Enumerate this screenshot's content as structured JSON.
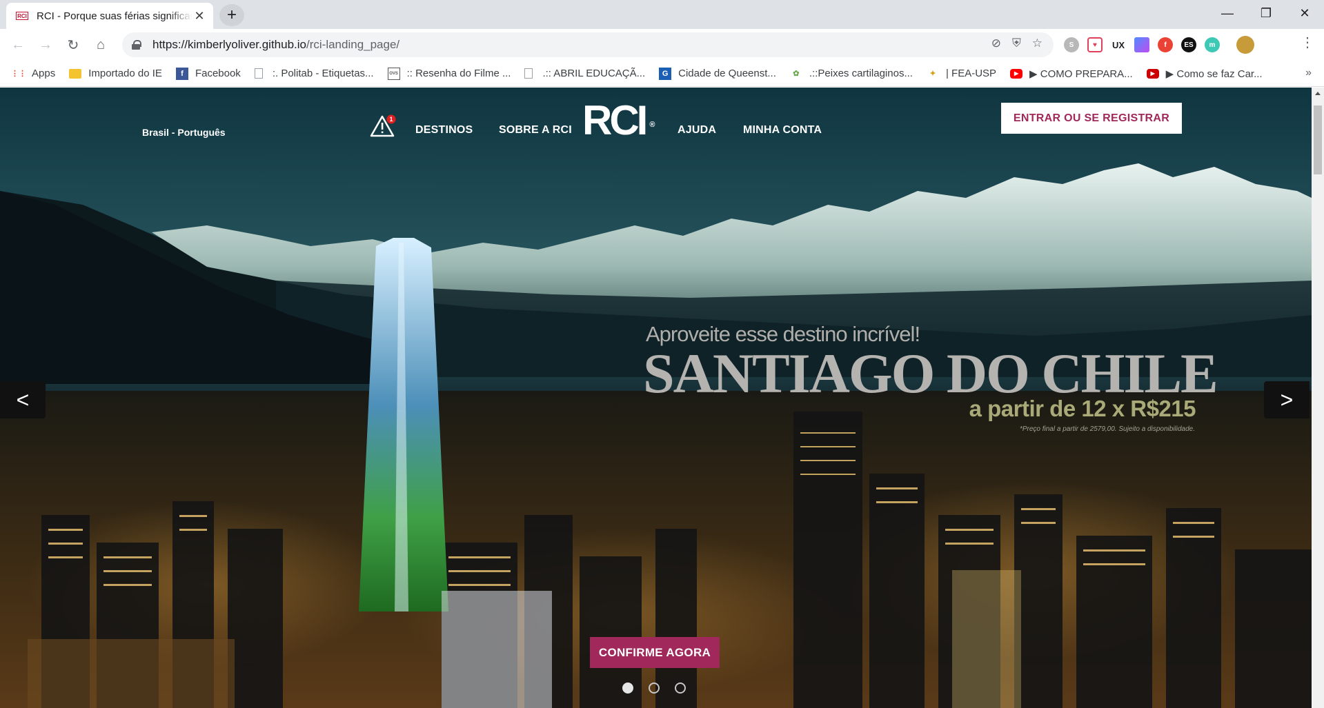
{
  "browser": {
    "tab": {
      "title": "RCI - Porque suas férias significam",
      "favicon_text": "RCI"
    },
    "new_tab_symbol": "+",
    "window_controls": {
      "minimize": "—",
      "maximize": "❐",
      "close": "✕"
    },
    "nav": {
      "back": "←",
      "forward": "→",
      "reload": "↻",
      "home": "⌂"
    },
    "url": {
      "host": "https://kimberlyoliver.github.io",
      "path": "/rci-landing_page/"
    },
    "omnibox_icons": [
      "translate-icon",
      "shield-icon",
      "star-icon"
    ],
    "extensions": [
      {
        "name": "skype-icon",
        "text": "S",
        "color": "#b8b8b8"
      },
      {
        "name": "pocket-icon",
        "text": "♥",
        "color": "#e0405a"
      },
      {
        "name": "ux-icon",
        "text": "UX",
        "color": "#202124"
      },
      {
        "name": "gradient-icon",
        "text": "",
        "color": "#8a5cf6"
      },
      {
        "name": "red-ext-icon",
        "text": "f",
        "color": "#ea4335"
      },
      {
        "name": "es-icon",
        "text": "ES",
        "color": "#111111"
      },
      {
        "name": "m-icon",
        "text": "m",
        "color": "#3ec9b6"
      },
      {
        "name": "profile-avatar",
        "text": "",
        "color": "#c79a3a"
      }
    ],
    "bookmarks": [
      {
        "label": "Apps",
        "icon": "apps-grid-icon",
        "glyph": "⋮⋮",
        "color": "#ea4335"
      },
      {
        "label": "Importado do IE",
        "icon": "folder-icon",
        "glyph": "",
        "color": "#f4c430"
      },
      {
        "label": "Facebook",
        "icon": "facebook-icon",
        "glyph": "f",
        "color": "#3b5998"
      },
      {
        "label": ":. Politab - Etiquetas...",
        "icon": "page-icon",
        "glyph": "",
        "color": "#9aa0a6"
      },
      {
        "label": ":: Resenha do Filme ...",
        "icon": "ovs-icon",
        "glyph": "OVS",
        "color": "#555555"
      },
      {
        "label": ".:: ABRIL EDUCAÇÃ...",
        "icon": "page-icon",
        "glyph": "",
        "color": "#9aa0a6"
      },
      {
        "label": "Cidade de Queenst...",
        "icon": "g-icon",
        "glyph": "G",
        "color": "#1a5fb4"
      },
      {
        "label": ".::Peixes cartilaginos...",
        "icon": "fish-icon",
        "glyph": "✿",
        "color": "#6aa84f"
      },
      {
        "label": "| FEA-USP",
        "icon": "fea-icon",
        "glyph": "✦",
        "color": "#d4a017"
      },
      {
        "label": "▶ COMO PREPARA...",
        "icon": "youtube-icon",
        "glyph": "▶",
        "color": "#ff0000"
      },
      {
        "label": "▶ Como se faz Car...",
        "icon": "youtube-icon",
        "glyph": "▶",
        "color": "#cc0000"
      }
    ],
    "bookmarks_more": "»"
  },
  "site": {
    "language": "Brasil - Português",
    "alert_badge": "1",
    "nav": {
      "destinos": "DESTINOS",
      "sobre": "SOBRE A RCI",
      "ajuda": "AJUDA",
      "conta": "MINHA CONTA"
    },
    "logo": "RCI",
    "logo_mark": "®",
    "signin_label": "ENTRAR OU SE REGISTRAR",
    "slide": {
      "subtitle": "Aproveite esse destino incrível!",
      "title": "SANTIAGO DO CHILE",
      "price": "a partir de 12 x R$215",
      "note": "*Preço final a partir de 2579,00. Sujeito a disponibilidade."
    },
    "carousel": {
      "prev": "<",
      "next": ">",
      "active_slide": 1,
      "total_slides": 3
    },
    "cta_label": "CONFIRME AGORA"
  }
}
